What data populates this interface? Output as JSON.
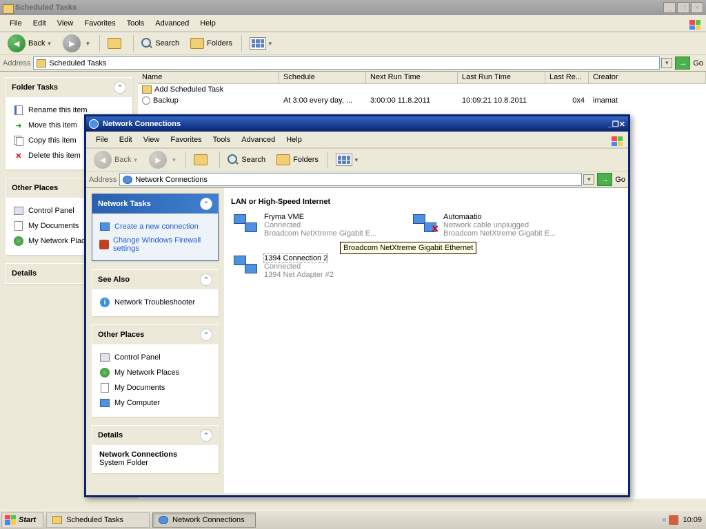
{
  "parent_window": {
    "title": "Scheduled Tasks",
    "menus": [
      "File",
      "Edit",
      "View",
      "Favorites",
      "Tools",
      "Advanced",
      "Help"
    ],
    "toolbar": {
      "back": "Back",
      "search": "Search",
      "folders": "Folders"
    },
    "address_label": "Address",
    "address_value": "Scheduled Tasks",
    "go_label": "Go",
    "columns": {
      "name": "Name",
      "schedule": "Schedule",
      "next_run": "Next Run Time",
      "last_run": "Last Run Time",
      "last_result": "Last Re...",
      "creator": "Creator"
    },
    "rows": [
      {
        "name": "Add Scheduled Task",
        "schedule": "",
        "next_run": "",
        "last_run": "",
        "last_result": "",
        "creator": ""
      },
      {
        "name": "Backup",
        "schedule": "At 3:00 every day, ...",
        "next_run": "3:00:00  11.8.2011",
        "last_run": "10:09:21  10.8.2011",
        "last_result": "0x4",
        "creator": "imamat"
      }
    ],
    "folder_tasks": {
      "header": "Folder Tasks",
      "items": [
        "Rename this item",
        "Move this item",
        "Copy this item",
        "Delete this item"
      ]
    },
    "other_places": {
      "header": "Other Places",
      "items": [
        "Control Panel",
        "My Documents",
        "My Network Places"
      ]
    },
    "details_header": "Details"
  },
  "child_window": {
    "title": "Network Connections",
    "menus": [
      "File",
      "Edit",
      "View",
      "Favorites",
      "Tools",
      "Advanced",
      "Help"
    ],
    "toolbar": {
      "back": "Back",
      "search": "Search",
      "folders": "Folders"
    },
    "address_label": "Address",
    "address_value": "Network Connections",
    "go_label": "Go",
    "section_header": "LAN or High-Speed Internet",
    "network_tasks": {
      "header": "Network Tasks",
      "items": [
        "Create a new connection",
        "Change Windows Firewall settings"
      ]
    },
    "see_also": {
      "header": "See Also",
      "items": [
        "Network Troubleshooter"
      ]
    },
    "other_places": {
      "header": "Other Places",
      "items": [
        "Control Panel",
        "My Network Places",
        "My Documents",
        "My Computer"
      ]
    },
    "details": {
      "header": "Details",
      "title": "Network Connections",
      "type": "System Folder"
    },
    "connections": [
      {
        "name": "Fryma VME",
        "status": "Connected",
        "device": "Broadcom NetXtreme Gigabit E..."
      },
      {
        "name": "Automaatio",
        "status": "Network cable unplugged",
        "device": "Broadcom NetXtreme Gigabit E...",
        "disconnected": true
      },
      {
        "name": "1394 Connection 2",
        "status": "Connected",
        "device": "1394 Net Adapter #2",
        "selected": true
      }
    ],
    "tooltip": "Broadcom NetXtreme Gigabit Ethernet"
  },
  "taskbar": {
    "start": "Start",
    "buttons": [
      "Scheduled Tasks",
      "Network Connections"
    ],
    "active_index": 1,
    "clock": "10:09"
  }
}
